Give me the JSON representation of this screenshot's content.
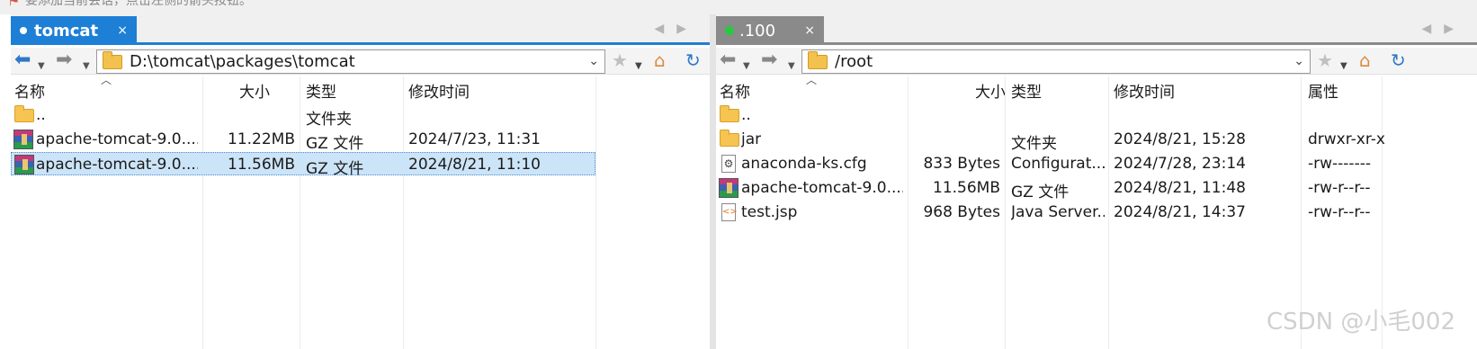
{
  "hint": "要添加当前会话，点击左侧的箭头按钮。",
  "left": {
    "tab": {
      "label": "tomcat",
      "close": "×"
    },
    "path": "D:\\tomcat\\packages\\tomcat",
    "columns": {
      "name": "名称",
      "size": "大小",
      "type": "类型",
      "modified": "修改时间"
    },
    "rows": [
      {
        "name": "..",
        "size": "",
        "type": "文件夹",
        "modified": "",
        "icon": "folder-icon"
      },
      {
        "name": "apache-tomcat-9.0....",
        "size": "11.22MB",
        "type": "GZ 文件",
        "modified": "2024/7/23, 11:31",
        "icon": "archive-icon"
      },
      {
        "name": "apache-tomcat-9.0....",
        "size": "11.56MB",
        "type": "GZ 文件",
        "modified": "2024/8/21, 11:10",
        "icon": "archive-icon",
        "selected": true
      }
    ]
  },
  "right": {
    "tab": {
      "label": ".100",
      "close": "×"
    },
    "path": "/root",
    "columns": {
      "name": "名称",
      "size": "大小",
      "type": "类型",
      "modified": "修改时间",
      "attrs": "属性"
    },
    "rows": [
      {
        "name": "..",
        "size": "",
        "type": "",
        "modified": "",
        "attrs": "",
        "icon": "folder-icon"
      },
      {
        "name": "jar",
        "size": "",
        "type": "文件夹",
        "modified": "2024/8/21, 15:28",
        "attrs": "drwxr-xr-x",
        "icon": "folder-icon"
      },
      {
        "name": "anaconda-ks.cfg",
        "size": "833 Bytes",
        "type": "Configurat...",
        "modified": "2024/7/28, 23:14",
        "attrs": "-rw-------",
        "icon": "config-file-icon"
      },
      {
        "name": "apache-tomcat-9.0....",
        "size": "11.56MB",
        "type": "GZ 文件",
        "modified": "2024/8/21, 11:48",
        "attrs": "-rw-r--r--",
        "icon": "archive-icon"
      },
      {
        "name": "test.jsp",
        "size": "968 Bytes",
        "type": "Java Server...",
        "modified": "2024/8/21, 14:37",
        "attrs": "-rw-r--r--",
        "icon": "jsp-file-icon"
      }
    ]
  },
  "watermark": "CSDN @小毛002"
}
